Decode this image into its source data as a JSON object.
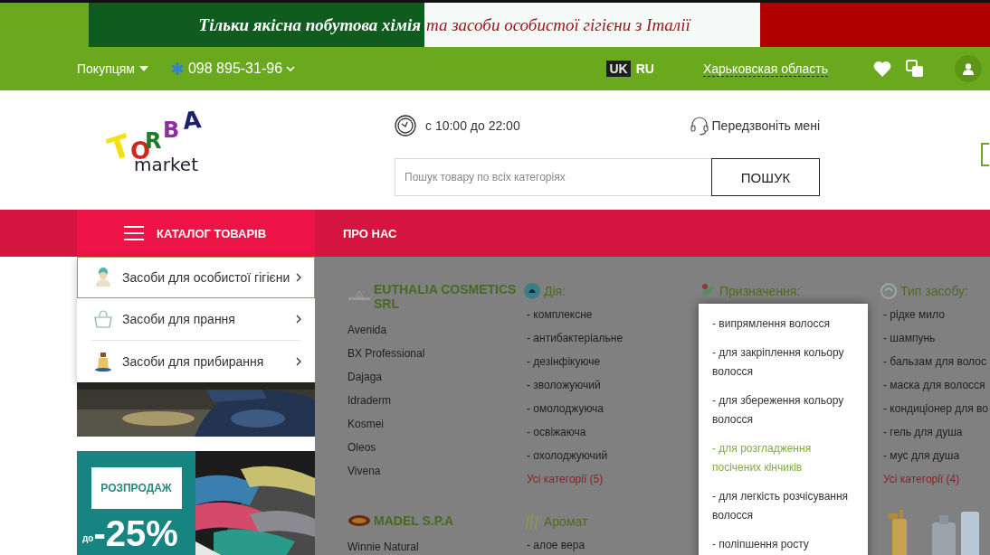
{
  "banner": {
    "segments": [
      {
        "text": "Тільки якісна побутова хімія",
        "kind": "green"
      },
      {
        "text": "та засоби особистої гігієни з Італії",
        "kind": "white"
      }
    ]
  },
  "top_bar": {
    "buyers_menu": "Покупцям",
    "phone": "098 895-31-96",
    "languages": [
      {
        "label": "UK",
        "selected": true
      },
      {
        "label": "RU",
        "selected": false
      }
    ],
    "region": "Харьковская область"
  },
  "logo": {
    "letters": [
      {
        "text": "T",
        "color": "#f2e20c"
      },
      {
        "text": "O",
        "color": "#d0271d"
      },
      {
        "text": "R",
        "color": "#1f7a2a"
      },
      {
        "text": "B",
        "color": "#8e2fa0"
      },
      {
        "text": "A",
        "color": "#1b1f6e"
      }
    ],
    "subtitle": "market"
  },
  "header": {
    "hours": "с 10:00 до 22:00",
    "callback": "Передзвоніть мені",
    "search": {
      "placeholder": "Пошук товару по всіх категоріях",
      "button": "ПОШУК"
    }
  },
  "nav": {
    "items": [
      {
        "label": "КАТАЛОГ ТОВАРІВ",
        "selected": true
      },
      {
        "label": "ПРО НАС",
        "selected": false
      }
    ]
  },
  "catalog": {
    "items": [
      {
        "label": "Засоби для особистої гігієни",
        "selected": true,
        "kind": "person"
      },
      {
        "label": "Засоби для прання",
        "selected": false,
        "kind": "basin"
      },
      {
        "label": "Засоби для прибирання",
        "selected": false,
        "kind": "bottle"
      }
    ]
  },
  "promo": {
    "title": "РОЗПРОДАЖ",
    "prefix": "до",
    "discount": "-25%"
  },
  "mega_menu": {
    "brands": [
      {
        "name": "EUTHALIA COSMETICS SRL",
        "items": [
          "Avenida",
          "BX Professional",
          "Dajaga",
          "Idraderm",
          "Kosmei",
          "Oleos",
          "Vivena"
        ]
      },
      {
        "name": "MADEL S.P.A",
        "items": [
          "Winnie Natural"
        ]
      }
    ],
    "columns": [
      {
        "groups": [
          {
            "title": "Дія:",
            "kind": "list",
            "items": [
              "- комплексне",
              "- антибактеріальне",
              "- дезінфікуюче",
              "- зволожуючий",
              "- омолоджуюча",
              "- освіжаюча",
              "- охолоджуючий"
            ],
            "all_link": "Усі категорії (5)"
          },
          {
            "title": "Аромат",
            "kind": "list",
            "items": [
              "- алое вера"
            ]
          }
        ]
      },
      {
        "groups": [
          {
            "title": "Призначення:",
            "kind": "popup",
            "items": [
              {
                "label": "- випрямлення волосся",
                "highlighted": false
              },
              {
                "label": "- для закріплення кольору волосся",
                "highlighted": false
              },
              {
                "label": "- для збереження кольору волосся",
                "highlighted": false
              },
              {
                "label": "- для розгладження посічених кінчиків",
                "highlighted": true
              },
              {
                "label": "- для легкість розчісування волосся",
                "highlighted": false
              },
              {
                "label": "- поліпшення росту",
                "highlighted": false
              }
            ]
          }
        ]
      },
      {
        "groups": [
          {
            "title": "Тип засобу:",
            "kind": "list",
            "items": [
              "- рідке мило",
              "- шампунь",
              "- бальзам для волос",
              "- маска для волосся",
              "- кондиціонер для во",
              "- гель для душа",
              "- мус для душа"
            ],
            "all_link": "Усі категорії (4)"
          }
        ]
      }
    ]
  }
}
